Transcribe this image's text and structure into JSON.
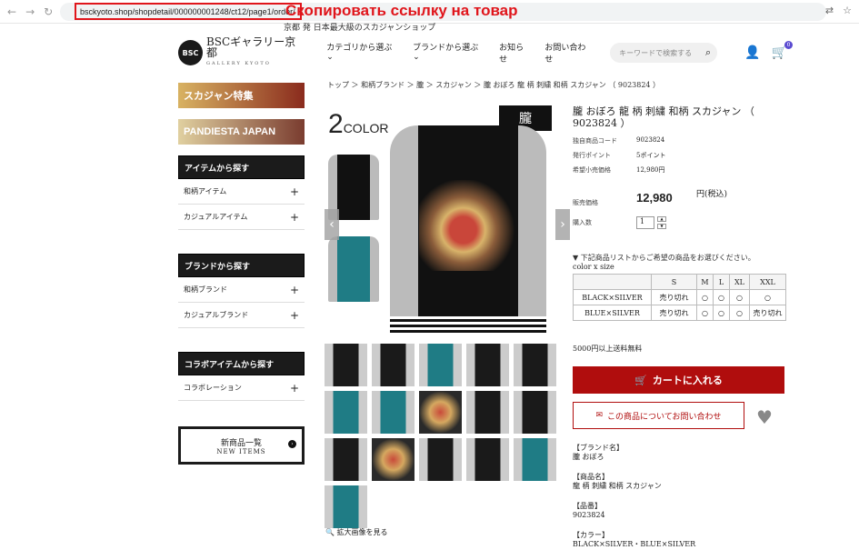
{
  "browser": {
    "url": "bsckyoto.shop/shopdetail/000000001248/ct12/page1/order/",
    "annotation": "Скопировать ссылку на товар"
  },
  "site": {
    "tagline": "京都 発 日本最大級のスカジャンショップ",
    "logo_mark": "BSC",
    "logo_name": "BSCギャラリー京都",
    "logo_sub": "GALLERY KYOTO"
  },
  "menu": [
    "カテゴリから選ぶ ⌄",
    "ブランドから選ぶ ⌄",
    "お知らせ",
    "お問い合わせ"
  ],
  "search": {
    "placeholder": "キーワードで検索する"
  },
  "cart_count": "0",
  "sidebar": {
    "banner1": "スカジャン特集",
    "banner2": "PANDIESTA JAPAN",
    "sec1": {
      "title": "アイテムから探す",
      "items": [
        "和柄アイテム",
        "カジュアルアイテム"
      ]
    },
    "sec2": {
      "title": "ブランドから探す",
      "items": [
        "和柄ブランド",
        "カジュアルブランド"
      ]
    },
    "sec3": {
      "title": "コラボアイテムから探す",
      "items": [
        "コラボレーション"
      ]
    },
    "new_items": "新商品一覧",
    "new_items_en": "NEW ITEMS"
  },
  "breadcrumb": "トップ ＞ 和柄ブランド ＞ 朧 ＞ スカジャン ＞ 朧 おぼろ 龍 柄 刺繍 和柄 スカジャン （ 9023824 ）",
  "gallery": {
    "twocolor_num": "2",
    "twocolor_txt": "COLOR",
    "brand": "朧",
    "zoom": "拡大画像を見る"
  },
  "product": {
    "title": "朧 おぼろ 龍 柄 刺繍 和柄 スカジャン （ 9023824 ）",
    "code_label": "独自商品コード",
    "code": "9023824",
    "points_label": "発行ポイント",
    "points": "5ポイント",
    "retail_label": "希望小売価格",
    "retail": "12,980円",
    "price_label": "販売価格",
    "price": "12,980",
    "price_tax": "円(税込)",
    "qty_label": "購入数",
    "qty": "1"
  },
  "stock": {
    "note": "▼ 下記商品リストからご希望の商品をお選びください。",
    "axis": "color x size",
    "sizes": [
      "S",
      "M",
      "L",
      "XL",
      "XXL"
    ],
    "rows": [
      {
        "color": "BLACK×SILVER",
        "cells": [
          "売り切れ",
          "○",
          "○",
          "○",
          "○"
        ]
      },
      {
        "color": "BLUE×SILVER",
        "cells": [
          "売り切れ",
          "○",
          "○",
          "○",
          "売り切れ"
        ]
      }
    ]
  },
  "shipping": "5000円以上送料無料",
  "cart_button": "カートに入れる",
  "inquiry_button": "この商品についてお問い合わせ",
  "details": [
    {
      "label": "【ブランド名】",
      "value": "朧 おぼろ"
    },
    {
      "label": "【商品名】",
      "value": "龍 柄 刺繍 和柄 スカジャン"
    },
    {
      "label": "【品番】",
      "value": "9023824"
    },
    {
      "label": "【カラー】",
      "value": "BLACK×SILVER・BLUE×SILVER"
    }
  ]
}
